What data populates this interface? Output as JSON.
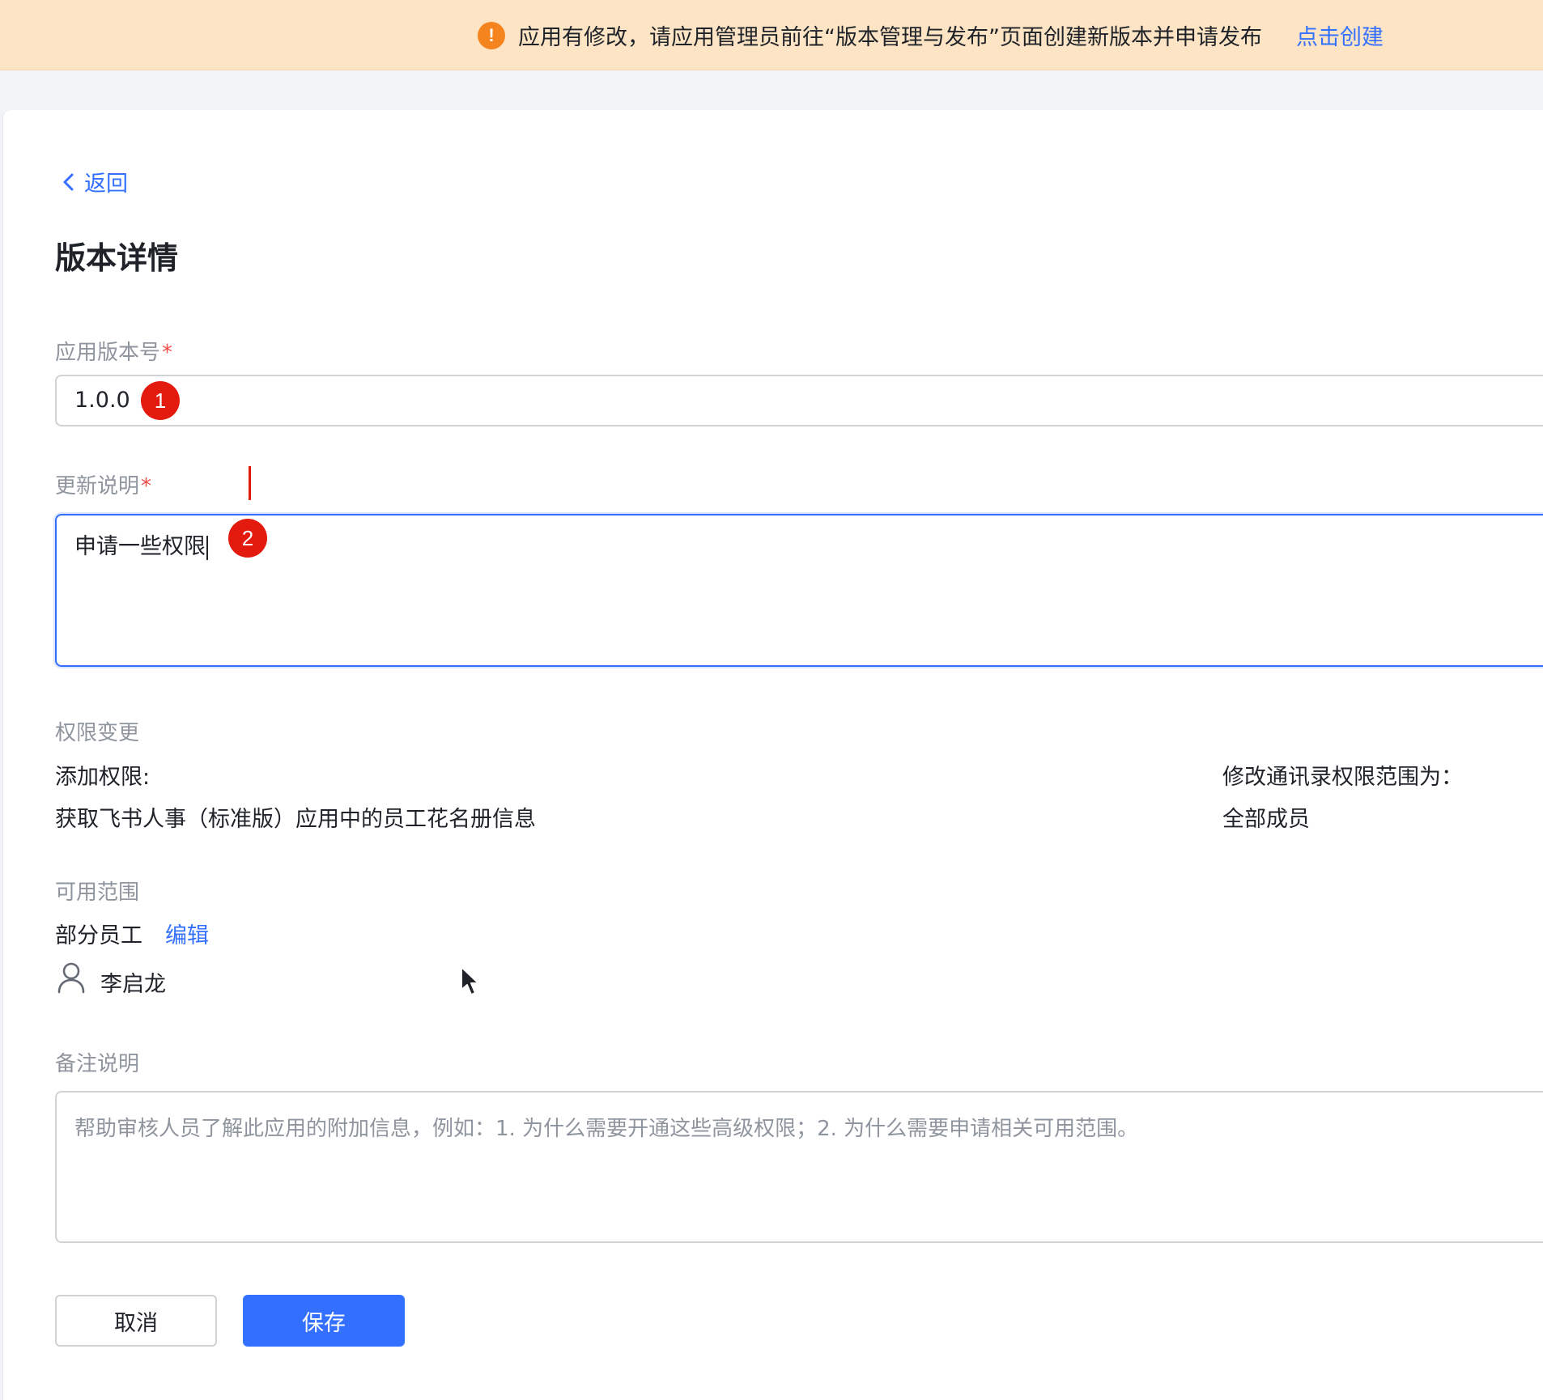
{
  "banner": {
    "icon": "warning-icon",
    "message": "应用有修改，请应用管理员前往“版本管理与发布”页面创建新版本并申请发布",
    "link_label": "点击创建",
    "accent": "#f5841f",
    "background": "#fce4c4"
  },
  "nav": {
    "back_label": "返回"
  },
  "page": {
    "title": "版本详情"
  },
  "version": {
    "label": "应用版本号",
    "required_mark": "*",
    "value": "1.0.0",
    "marker": "1"
  },
  "update_notes": {
    "label": "更新说明",
    "required_mark": "*",
    "value": "申请一些权限",
    "marker": "2"
  },
  "permissions": {
    "label": "权限变更",
    "add_label": "添加权限:",
    "add_item": "获取飞书人事（标准版）应用中的员工花名册信息",
    "scope_label": "修改通讯录权限范围为：",
    "scope_value": "全部成员"
  },
  "availability": {
    "label": "可用范围",
    "value": "部分员工",
    "edit_label": "编辑",
    "member_name": "李启龙",
    "member_icon": "user-icon"
  },
  "remarks": {
    "label": "备注说明",
    "placeholder": "帮助审核人员了解此应用的附加信息，例如：1. 为什么需要开通这些高级权限；2. 为什么需要申请相关可用范围。"
  },
  "actions": {
    "cancel_label": "取消",
    "save_label": "保存",
    "primary_color": "#3370ff"
  }
}
